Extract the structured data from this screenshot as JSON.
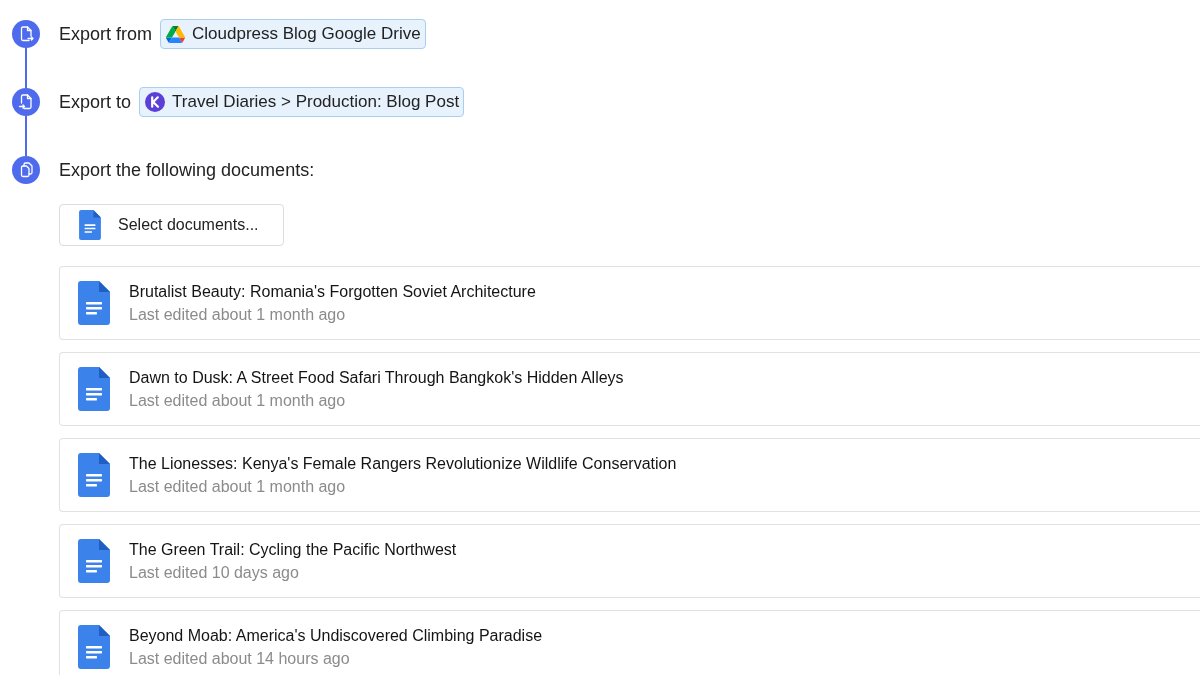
{
  "steps": [
    {
      "kind": "export_from",
      "label": "Export from",
      "target": {
        "kind": "drive",
        "text": "Cloudpress Blog Google Drive"
      }
    },
    {
      "kind": "export_to",
      "label": "Export to",
      "target": {
        "kind": "cms",
        "text": "Travel Diaries > Production: Blog Post"
      }
    },
    {
      "kind": "documents",
      "label": "Export the following documents:"
    }
  ],
  "select_button": {
    "label": "Select documents..."
  },
  "documents": [
    {
      "title": "Brutalist Beauty: Romania's Forgotten Soviet Architecture",
      "edited": "Last edited about 1 month ago"
    },
    {
      "title": "Dawn to Dusk: A Street Food Safari Through Bangkok's Hidden Alleys",
      "edited": "Last edited about 1 month ago"
    },
    {
      "title": "The Lionesses: Kenya's Female Rangers Revolutionize Wildlife Conservation",
      "edited": "Last edited about 1 month ago"
    },
    {
      "title": "The Green Trail: Cycling the Pacific Northwest",
      "edited": "Last edited 10 days ago"
    },
    {
      "title": "Beyond Moab: America's Undiscovered Climbing Paradise",
      "edited": "Last edited about 14 hours ago"
    }
  ]
}
